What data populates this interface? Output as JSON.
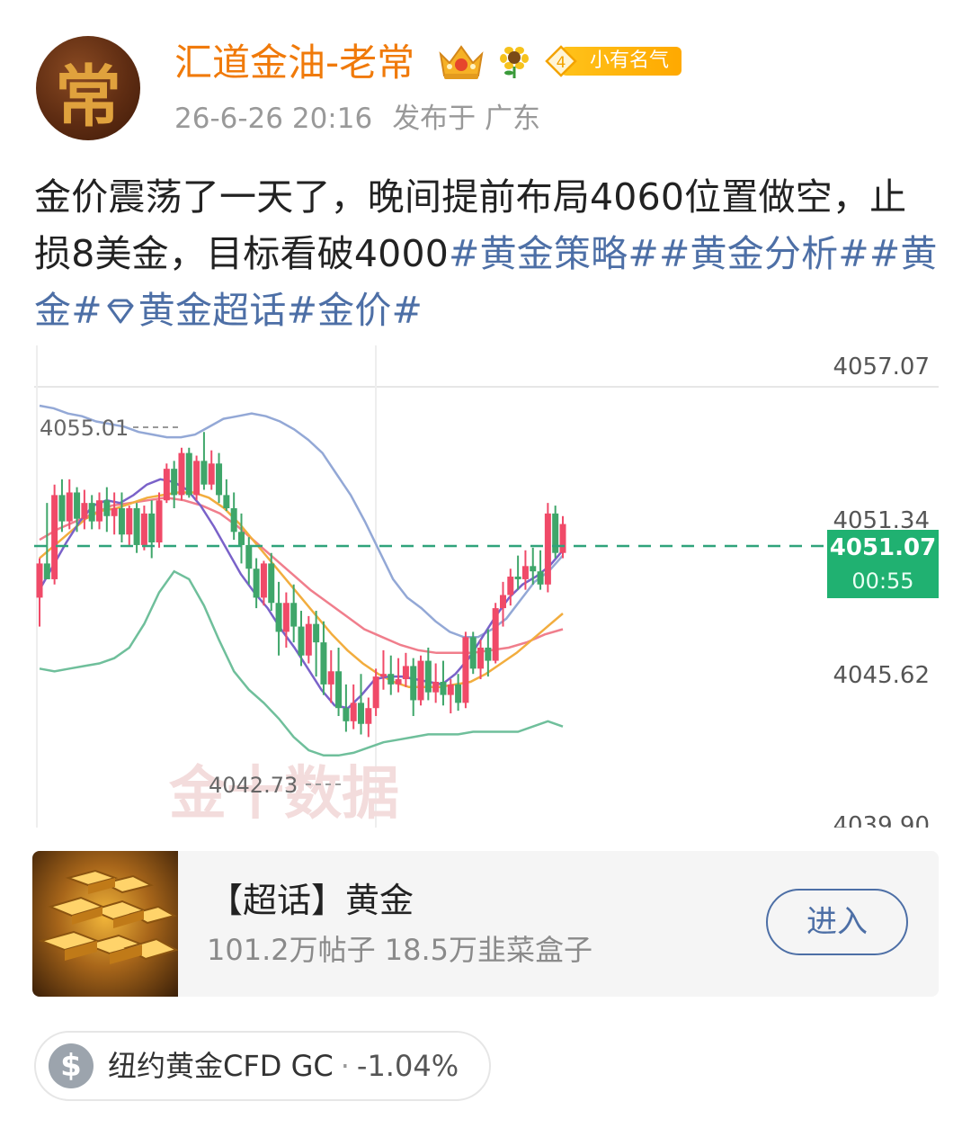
{
  "post": {
    "author": "汇道金油-老常",
    "avatar_char": "常",
    "level_number": "4",
    "level_title": "小有名气",
    "timestamp": "26-6-26 20:16",
    "location": "发布于 广东",
    "text_parts": [
      {
        "text": "金价震荡了一天了，晚间提前布局4060位置做空，止损8美金，目标看破4000",
        "hashtag": false
      },
      {
        "text": "#黄金策略#",
        "hashtag": true
      },
      {
        "text": "#黄金分析#",
        "hashtag": true
      },
      {
        "text": "#黄金#",
        "hashtag": true
      },
      {
        "text": "黄金超话",
        "hashtag": true,
        "icon": "diamond-icon"
      },
      {
        "text": "#金价#",
        "hashtag": true
      }
    ]
  },
  "chart_data": {
    "type": "line",
    "title": "",
    "watermark": "金十数据",
    "price_labels": [
      "4057.07",
      "4051.34",
      "4045.62",
      "4039.90"
    ],
    "current_price": "4051.07",
    "countdown": "00:55",
    "high_label": "4055.01",
    "low_label": "4042.73",
    "ylim": [
      4039.9,
      4057.07
    ],
    "candles": [
      [
        4048.3,
        4049.8,
        4047.2,
        4049.6
      ],
      [
        4049.6,
        4051.9,
        4049.0,
        4049.0
      ],
      [
        4049.0,
        4052.6,
        4048.8,
        4052.2
      ],
      [
        4052.2,
        4052.8,
        4050.8,
        4051.2
      ],
      [
        4051.2,
        4052.8,
        4050.9,
        4052.3
      ],
      [
        4052.3,
        4052.5,
        4050.8,
        4051.3
      ],
      [
        4051.3,
        4052.4,
        4050.9,
        4051.9
      ],
      [
        4051.9,
        4052.2,
        4050.9,
        4051.2
      ],
      [
        4051.2,
        4052.3,
        4050.9,
        4052.0
      ],
      [
        4052.0,
        4052.5,
        4050.8,
        4051.4
      ],
      [
        4051.4,
        4052.3,
        4050.7,
        4051.7
      ],
      [
        4051.7,
        4052.3,
        4050.4,
        4050.7
      ],
      [
        4050.7,
        4051.8,
        4050.3,
        4051.7
      ],
      [
        4051.7,
        4051.9,
        4050.0,
        4050.3
      ],
      [
        4050.3,
        4051.8,
        4050.1,
        4051.5
      ],
      [
        4051.5,
        4052.0,
        4049.8,
        4050.4
      ],
      [
        4050.4,
        4052.3,
        4050.2,
        4052.0
      ],
      [
        4052.0,
        4053.4,
        4051.9,
        4053.2
      ],
      [
        4053.2,
        4053.5,
        4051.7,
        4052.2
      ],
      [
        4052.2,
        4054.0,
        4052.0,
        4053.8
      ],
      [
        4053.8,
        4054.0,
        4052.1,
        4052.2
      ],
      [
        4052.2,
        4053.7,
        4052.0,
        4053.5
      ],
      [
        4053.5,
        4054.6,
        4052.4,
        4052.6
      ],
      [
        4052.6,
        4053.9,
        4052.4,
        4053.4
      ],
      [
        4053.4,
        4053.8,
        4051.9,
        4052.2
      ],
      [
        4052.2,
        4052.8,
        4051.6,
        4051.7
      ],
      [
        4051.7,
        4052.3,
        4050.5,
        4050.8
      ],
      [
        4050.8,
        4051.5,
        4049.6,
        4050.3
      ],
      [
        4050.3,
        4050.6,
        4048.8,
        4049.4
      ],
      [
        4049.4,
        4049.8,
        4047.9,
        4048.3
      ],
      [
        4048.3,
        4049.7,
        4048.0,
        4049.6
      ],
      [
        4049.6,
        4050.0,
        4047.8,
        4048.1
      ],
      [
        4048.1,
        4048.9,
        4046.1,
        4047.0
      ],
      [
        4047.0,
        4048.5,
        4046.4,
        4048.1
      ],
      [
        4048.1,
        4048.8,
        4046.6,
        4047.2
      ],
      [
        4047.2,
        4047.8,
        4045.7,
        4046.1
      ],
      [
        4046.1,
        4047.6,
        4045.8,
        4047.3
      ],
      [
        4047.3,
        4047.8,
        4045.3,
        4046.6
      ],
      [
        4046.6,
        4047.4,
        4044.6,
        4045.0
      ],
      [
        4045.0,
        4046.3,
        4044.3,
        4045.5
      ],
      [
        4045.5,
        4046.4,
        4043.8,
        4044.1
      ],
      [
        4044.1,
        4045.0,
        4043.2,
        4043.6
      ],
      [
        4043.6,
        4045.0,
        4043.3,
        4044.3
      ],
      [
        4044.3,
        4045.4,
        4043.1,
        4043.5
      ],
      [
        4043.5,
        4044.5,
        4043.0,
        4044.1
      ],
      [
        4044.1,
        4045.6,
        4043.8,
        4045.3
      ],
      [
        4045.3,
        4046.3,
        4044.8,
        4045.4
      ],
      [
        4045.4,
        4046.1,
        4044.6,
        4045.0
      ],
      [
        4045.0,
        4046.0,
        4044.7,
        4045.2
      ],
      [
        4045.2,
        4046.2,
        4044.9,
        4045.7
      ],
      [
        4045.7,
        4046.0,
        4043.8,
        4044.4
      ],
      [
        4044.4,
        4046.1,
        4044.2,
        4045.9
      ],
      [
        4045.9,
        4046.4,
        4044.4,
        4044.7
      ],
      [
        4044.7,
        4045.8,
        4044.3,
        4045.1
      ],
      [
        4045.1,
        4045.9,
        4044.2,
        4044.6
      ],
      [
        4044.6,
        4045.2,
        4043.9,
        4045.0
      ],
      [
        4045.0,
        4045.4,
        4044.0,
        4044.3
      ],
      [
        4044.3,
        4047.0,
        4044.1,
        4046.8
      ],
      [
        4046.8,
        4047.0,
        4045.4,
        4045.6
      ],
      [
        4045.6,
        4046.7,
        4045.2,
        4046.4
      ],
      [
        4046.4,
        4047.1,
        4045.3,
        4045.9
      ],
      [
        4045.9,
        4048.1,
        4045.8,
        4047.9
      ],
      [
        4047.9,
        4048.9,
        4047.2,
        4048.4
      ],
      [
        4048.4,
        4049.4,
        4048.0,
        4049.1
      ],
      [
        4049.1,
        4049.9,
        4048.6,
        4049.0
      ],
      [
        4049.0,
        4050.1,
        4048.6,
        4049.5
      ],
      [
        4049.5,
        4050.2,
        4048.8,
        4049.3
      ],
      [
        4049.3,
        4050.1,
        4048.6,
        4048.8
      ],
      [
        4048.8,
        4051.9,
        4048.5,
        4051.5
      ],
      [
        4051.5,
        4051.8,
        4049.8,
        4050.0
      ],
      [
        4050.0,
        4051.4,
        4049.8,
        4051.1
      ]
    ],
    "series": [
      {
        "name": "",
        "color": "#93a8d6",
        "values": [
          4055.6,
          4055.5,
          4055.3,
          4055.2,
          4055.0,
          4054.9,
          4054.8,
          4054.6,
          4054.5,
          4054.4,
          4054.4,
          4054.5,
          4054.8,
          4055.1,
          4055.2,
          4055.3,
          4055.2,
          4055.0,
          4054.7,
          4054.3,
          4053.8,
          4053.0,
          4052.2,
          4051.2,
          4050.1,
          4049.0,
          4048.3,
          4047.9,
          4047.4,
          4047.0,
          4046.8,
          4046.8,
          4047.1,
          4047.5,
          4048.2,
          4048.9,
          4049.3,
          4049.9
        ]
      },
      {
        "name": "",
        "color": "#f07e8c",
        "values": [
          4050.5,
          4050.9,
          4051.2,
          4051.5,
          4051.8,
          4051.9,
          4052.0,
          4052.1,
          4052.0,
          4051.8,
          4051.5,
          4051.0,
          4050.4,
          4049.8,
          4049.2,
          4048.6,
          4048.1,
          4047.6,
          4047.1,
          4046.8,
          4046.5,
          4046.3,
          4046.2,
          4046.2,
          4046.2,
          4046.3,
          4046.4,
          4046.6,
          4046.9,
          4047.1
        ]
      },
      {
        "name": "",
        "color": "#f2ad3e",
        "values": [
          4049.8,
          4050.3,
          4050.8,
          4051.3,
          4051.6,
          4051.7,
          4051.9,
          4052.1,
          4052.2,
          4052.3,
          4052.3,
          4052.1,
          4051.7,
          4051.1,
          4050.4,
          4049.7,
          4049.0,
          4048.3,
          4047.6,
          4046.9,
          4046.3,
          4045.8,
          4045.4,
          4045.1,
          4044.9,
          4044.9,
          4044.9,
          4045.0,
          4045.1,
          4045.4,
          4045.8,
          4046.2,
          4046.7,
          4047.2,
          4047.7
        ]
      },
      {
        "name": "",
        "color": "#7a62c9",
        "values": [
          4048.6,
          4049.5,
          4050.4,
          4051.2,
          4051.8,
          4052.0,
          4051.9,
          4052.2,
          4052.6,
          4052.8,
          4052.7,
          4052.4,
          4051.8,
          4051.0,
          4050.1,
          4049.2,
          4048.5,
          4047.9,
          4047.1,
          4046.4,
          4045.6,
          4044.8,
          4044.2,
          4044.1,
          4044.6,
          4045.2,
          4045.3,
          4045.3,
          4045.2,
          4045.1,
          4045.0,
          4045.4,
          4046.0,
          4046.8,
          4047.6,
          4048.3,
          4048.8,
          4049.1,
          4049.5,
          4050.1
        ]
      },
      {
        "name": "",
        "color": "#6fbf9b",
        "values": [
          4045.6,
          4045.5,
          4045.6,
          4045.7,
          4045.8,
          4046.0,
          4046.4,
          4047.3,
          4048.5,
          4049.3,
          4049.0,
          4048.0,
          4046.7,
          4045.5,
          4044.8,
          4044.3,
          4043.7,
          4043.0,
          4042.5,
          4042.3,
          4042.3,
          4042.4,
          4042.6,
          4042.8,
          4042.9,
          4043.0,
          4043.1,
          4043.1,
          4043.1,
          4043.2,
          4043.2,
          4043.2,
          4043.2,
          4043.4,
          4043.6,
          4043.4
        ]
      }
    ],
    "up_color": "#f04a68",
    "down_color": "#3fa66a"
  },
  "topic_card": {
    "title": "【超话】黄金",
    "stats": "101.2万帖子 18.5万韭菜盒子",
    "enter_label": "进入"
  },
  "stock": {
    "icon": "dollar-icon",
    "name": "纽约黄金CFD GC",
    "separator": "·",
    "change": "-1.04%"
  }
}
